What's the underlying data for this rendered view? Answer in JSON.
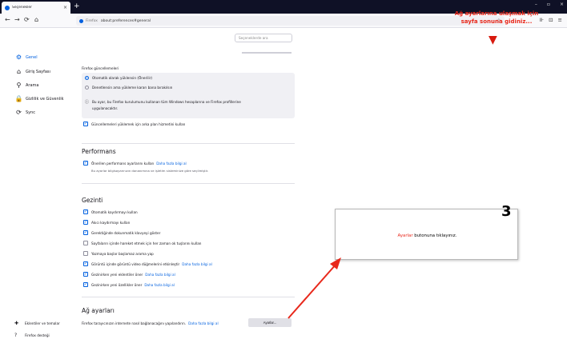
{
  "browser": {
    "tab_title": "Seçenekler",
    "tab_close": "×",
    "new_tab": "+",
    "window_controls": [
      "–",
      "▫",
      "×"
    ],
    "nav": {
      "back": "←",
      "forward": "→",
      "reload": "⟳",
      "home": "⌂"
    },
    "url_brand": "Firefox",
    "url": "about:preferences#general",
    "star": "☆",
    "toolbar_icons": [
      "⊪",
      "⊡",
      "≡"
    ]
  },
  "search": {
    "placeholder": "Seçeneklerde ara"
  },
  "sidebar": {
    "items": [
      {
        "label": "Genel",
        "icon": "gear-icon",
        "glyph": "⚙",
        "active": true
      },
      {
        "label": "Giriş Sayfası",
        "icon": "home-icon",
        "glyph": "⌂",
        "active": false
      },
      {
        "label": "Arama",
        "icon": "search-icon",
        "glyph": "⚲",
        "active": false
      },
      {
        "label": "Gizlilik ve Güvenlik",
        "icon": "lock-icon",
        "glyph": "🔒",
        "active": false
      },
      {
        "label": "Sync",
        "icon": "sync-icon",
        "glyph": "⟳",
        "active": false
      }
    ],
    "footer": [
      {
        "label": "Eklentiler ve temalar",
        "icon": "puzzle-icon",
        "glyph": "✚"
      },
      {
        "label": "Firefox desteği",
        "icon": "help-icon",
        "glyph": "?"
      }
    ]
  },
  "updates": {
    "heading": "Firefox güncellemeleri",
    "option_auto": "Otomatik olarak yüklensin (Önerilir)",
    "option_check": "Denetlensin ama yükleme kararı bana bırakılsın",
    "info": "Bu ayar, bu Firefox kurulumunu kullanan tüm Windows hesaplarına ve Firefox profillerine",
    "info2": "uygulanacaktır.",
    "background_service": "Güncellemeleri yüklemek için arka plan hizmetini kullan"
  },
  "performance": {
    "heading": "Performans",
    "recommended": "Önerilen performans ayarlarını kullan",
    "learn_more": "Daha fazla bilgi al",
    "note": "Bu ayarlar bilgisayarınızın donanımına ve işletim sisteminize göre seçilmiştir."
  },
  "browsing": {
    "heading": "Gezinti",
    "items": [
      {
        "label": "Otomatik kaydırmayı kullan",
        "checked": true,
        "link": ""
      },
      {
        "label": "Akıcı kaydırmayı kullan",
        "checked": true,
        "link": ""
      },
      {
        "label": "Gerektiğinde dokunmatik klavyeyi göster",
        "checked": true,
        "link": ""
      },
      {
        "label": "Sayfaların içinde hareket etmek için her zaman ok tuşlarını kullan",
        "checked": false,
        "link": ""
      },
      {
        "label": "Yazmaya başlar başlamaz arama yap",
        "checked": false,
        "link": ""
      },
      {
        "label": "Görüntü içinde görüntü video düğmelerini etkinleştir",
        "checked": true,
        "link": "Daha fazla bilgi al"
      },
      {
        "label": "Gezinirken yeni eklentiler öner",
        "checked": true,
        "link": "Daha fazla bilgi al"
      },
      {
        "label": "Gezinirken yeni özellikler öner",
        "checked": true,
        "link": "Daha fazla bilgi al"
      }
    ]
  },
  "network": {
    "heading": "Ağ ayarları",
    "description": "Firefox tarayıcınızın internete nasıl bağlanacağını yapılandırın.",
    "learn_more": "Daha fazla bilgi al",
    "settings_button": "Ayarlar..."
  },
  "annotations": {
    "top_line1": "Ağ ayarlarına ulaşmak için",
    "top_line2": "sayfa sonuna gidiniz...",
    "down_arrow": "▼",
    "step_number": "3",
    "callout_highlight": "Ayarlar",
    "callout_rest": " butonuna tıklayınız.",
    "accent_color": "#e8281b"
  }
}
